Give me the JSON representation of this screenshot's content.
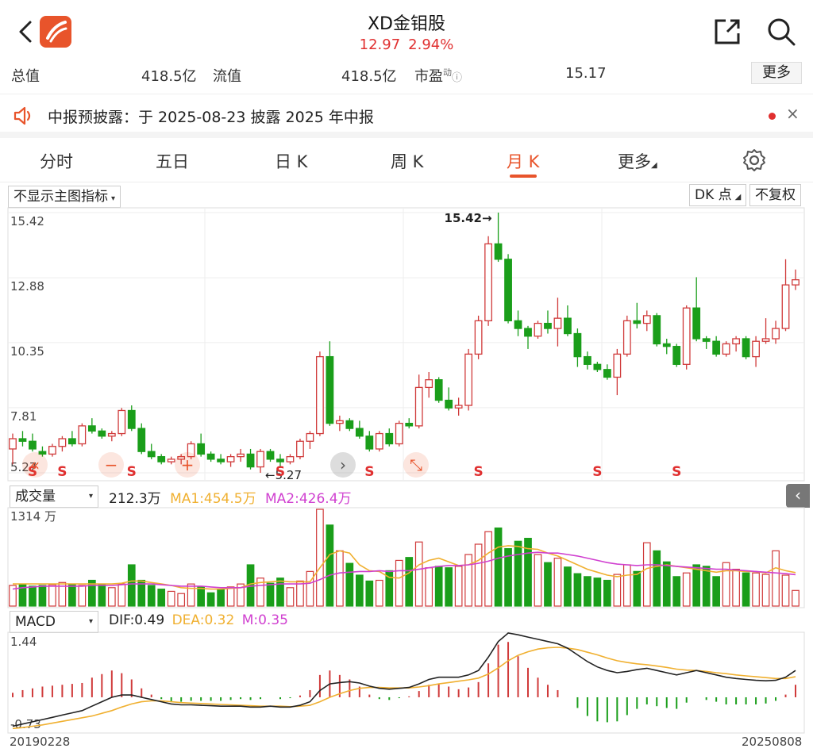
{
  "header": {
    "title": "XD金钼股",
    "price": "12.97",
    "change": "2.94%"
  },
  "stats": {
    "total_label": "总值",
    "total_value": "418.5亿",
    "float_label": "流值",
    "float_value": "418.5亿",
    "pe_label": "市盈",
    "pe_sup": "动",
    "pe_value": "15.17",
    "more_label": "更多"
  },
  "notice": {
    "text": "中报预披露：于 2025-08-23 披露 2025 年中报",
    "close": "×"
  },
  "tabs": [
    {
      "label": "分时"
    },
    {
      "label": "五日"
    },
    {
      "label": "日 K"
    },
    {
      "label": "周 K"
    },
    {
      "label": "月 K",
      "active": true
    },
    {
      "label": "更多"
    }
  ],
  "main_chart": {
    "indicator_select": "不显示主图指标",
    "dk_label": "DK 点",
    "fq_label": "不复权",
    "y_ticks": [
      "15.42",
      "12.88",
      "10.35",
      "7.81",
      "5.27"
    ],
    "max_label": "15.42",
    "min_label": "5.27",
    "signal_letter": "S",
    "colors": {
      "up": "#d03a3a",
      "down": "#1a9e1a",
      "grid": "#eeeeee"
    }
  },
  "volume": {
    "select": "成交量",
    "value": "212.3万",
    "ma1": "MA1:454.5万",
    "ma2": "MA2:426.4万",
    "y_max": "1314 万",
    "ma1_color": "#f0b030",
    "ma2_color": "#d040d0"
  },
  "macd": {
    "select": "MACD",
    "dif": "DIF:0.49",
    "dea": "DEA:0.32",
    "m": "M:0.35",
    "y_max": "1.44",
    "y_min": "-0.73"
  },
  "dates": {
    "start": "20190228",
    "end": "20250808"
  },
  "chart_data": {
    "type": "candlestick",
    "price_axis": [
      5.27,
      15.42
    ],
    "candles_ohlc": [
      [
        6.2,
        6.8,
        5.6,
        6.6
      ],
      [
        6.6,
        6.9,
        6.3,
        6.5
      ],
      [
        6.5,
        6.8,
        6.1,
        6.2
      ],
      [
        6.1,
        6.3,
        5.9,
        6.0
      ],
      [
        6.0,
        6.4,
        5.9,
        6.3
      ],
      [
        6.3,
        6.7,
        6.1,
        6.6
      ],
      [
        6.6,
        6.9,
        6.3,
        6.4
      ],
      [
        6.4,
        7.2,
        6.3,
        7.1
      ],
      [
        7.1,
        7.4,
        6.8,
        6.9
      ],
      [
        6.9,
        7.0,
        6.6,
        6.7
      ],
      [
        6.7,
        6.9,
        6.5,
        6.8
      ],
      [
        6.8,
        7.8,
        6.7,
        7.7
      ],
      [
        7.7,
        7.9,
        6.9,
        7.0
      ],
      [
        7.0,
        7.2,
        6.0,
        6.1
      ],
      [
        6.1,
        6.4,
        5.8,
        5.9
      ],
      [
        5.9,
        6.0,
        5.6,
        5.7
      ],
      [
        5.7,
        5.9,
        5.6,
        5.8
      ],
      [
        5.8,
        6.0,
        5.6,
        5.9
      ],
      [
        5.9,
        6.5,
        5.8,
        6.4
      ],
      [
        6.4,
        6.8,
        5.9,
        6.0
      ],
      [
        6.0,
        6.1,
        5.7,
        5.8
      ],
      [
        5.8,
        6.0,
        5.6,
        5.7
      ],
      [
        5.7,
        6.0,
        5.5,
        5.9
      ],
      [
        5.9,
        6.2,
        5.7,
        6.0
      ],
      [
        6.0,
        6.2,
        5.4,
        5.5
      ],
      [
        5.5,
        6.2,
        5.27,
        6.1
      ],
      [
        6.1,
        6.2,
        5.7,
        5.8
      ],
      [
        5.8,
        6.0,
        5.5,
        5.7
      ],
      [
        5.7,
        6.0,
        5.6,
        5.9
      ],
      [
        5.9,
        6.6,
        5.8,
        6.5
      ],
      [
        6.5,
        6.9,
        6.2,
        6.8
      ],
      [
        6.8,
        10.0,
        6.7,
        9.8
      ],
      [
        9.8,
        10.4,
        7.1,
        7.2
      ],
      [
        7.2,
        7.5,
        6.9,
        7.3
      ],
      [
        7.3,
        7.4,
        6.9,
        7.0
      ],
      [
        7.0,
        7.3,
        6.6,
        6.7
      ],
      [
        6.7,
        6.9,
        6.1,
        6.2
      ],
      [
        6.2,
        6.9,
        6.1,
        6.8
      ],
      [
        6.8,
        7.0,
        6.3,
        6.4
      ],
      [
        6.4,
        7.3,
        6.3,
        7.2
      ],
      [
        7.2,
        7.4,
        7.0,
        7.1
      ],
      [
        7.1,
        9.1,
        7.0,
        8.6
      ],
      [
        8.6,
        9.2,
        8.2,
        8.9
      ],
      [
        8.9,
        9.0,
        8.0,
        8.1
      ],
      [
        8.1,
        8.6,
        7.7,
        7.8
      ],
      [
        7.8,
        8.2,
        7.5,
        7.9
      ],
      [
        7.9,
        10.1,
        7.7,
        9.9
      ],
      [
        9.9,
        11.4,
        9.7,
        11.2
      ],
      [
        11.2,
        14.5,
        11.0,
        14.2
      ],
      [
        14.2,
        15.42,
        13.5,
        13.6
      ],
      [
        13.6,
        13.8,
        11.1,
        11.2
      ],
      [
        11.2,
        11.6,
        10.6,
        10.9
      ],
      [
        10.9,
        11.0,
        10.1,
        10.6
      ],
      [
        10.6,
        11.2,
        10.5,
        11.1
      ],
      [
        11.1,
        11.6,
        10.7,
        10.9
      ],
      [
        10.9,
        12.1,
        10.2,
        11.3
      ],
      [
        11.3,
        11.8,
        10.6,
        10.7
      ],
      [
        10.7,
        10.9,
        9.4,
        9.8
      ],
      [
        9.8,
        10.0,
        9.3,
        9.5
      ],
      [
        9.5,
        9.6,
        9.2,
        9.3
      ],
      [
        9.3,
        9.5,
        8.9,
        9.0
      ],
      [
        9.0,
        10.1,
        8.3,
        9.9
      ],
      [
        9.9,
        11.4,
        9.8,
        11.2
      ],
      [
        11.2,
        11.9,
        10.9,
        11.1
      ],
      [
        11.1,
        11.6,
        10.8,
        11.4
      ],
      [
        11.4,
        11.5,
        10.2,
        10.3
      ],
      [
        10.3,
        10.5,
        9.9,
        10.2
      ],
      [
        10.2,
        10.3,
        9.4,
        9.5
      ],
      [
        9.5,
        11.8,
        9.3,
        11.7
      ],
      [
        11.7,
        12.9,
        10.4,
        10.5
      ],
      [
        10.5,
        10.6,
        10.1,
        10.4
      ],
      [
        10.4,
        10.6,
        9.8,
        9.9
      ],
      [
        9.9,
        10.4,
        9.8,
        10.3
      ],
      [
        10.3,
        10.6,
        10.0,
        10.5
      ],
      [
        10.5,
        10.6,
        9.7,
        9.8
      ],
      [
        9.8,
        10.6,
        9.4,
        10.4
      ],
      [
        10.4,
        11.3,
        10.3,
        10.5
      ],
      [
        10.5,
        11.2,
        10.3,
        10.9
      ],
      [
        10.9,
        13.6,
        10.8,
        12.6
      ],
      [
        12.6,
        13.2,
        12.4,
        12.8
      ]
    ],
    "volume_wan": [
      280,
      300,
      270,
      280,
      290,
      320,
      300,
      280,
      350,
      290,
      250,
      300,
      560,
      350,
      280,
      230,
      200,
      170,
      300,
      260,
      180,
      230,
      260,
      300,
      560,
      380,
      310,
      380,
      250,
      340,
      470,
      1314,
      1100,
      750,
      580,
      420,
      340,
      350,
      480,
      620,
      660,
      870,
      520,
      540,
      520,
      540,
      700,
      840,
      1010,
      1060,
      780,
      880,
      920,
      700,
      590,
      650,
      530,
      440,
      400,
      380,
      350,
      430,
      560,
      470,
      860,
      750,
      600,
      400,
      450,
      560,
      540,
      400,
      590,
      500,
      450,
      450,
      430,
      750,
      420,
      212
    ],
    "volume_ma1_wan": [
      300,
      300,
      300,
      300,
      300,
      300,
      300,
      300,
      300,
      300,
      300,
      310,
      340,
      340,
      320,
      300,
      280,
      250,
      240,
      240,
      230,
      230,
      240,
      250,
      300,
      320,
      330,
      340,
      330,
      330,
      330,
      520,
      700,
      750,
      720,
      560,
      480,
      470,
      390,
      380,
      450,
      560,
      620,
      650,
      600,
      550,
      560,
      620,
      720,
      800,
      820,
      810,
      780,
      770,
      720,
      680,
      620,
      560,
      500,
      460,
      420,
      400,
      420,
      430,
      510,
      540,
      560,
      540,
      520,
      500,
      480,
      460,
      480,
      480,
      470,
      470,
      450,
      520,
      480,
      454
    ],
    "volume_ma2_wan": [
      230,
      250,
      260,
      270,
      270,
      270,
      270,
      270,
      280,
      280,
      280,
      290,
      300,
      300,
      300,
      290,
      280,
      270,
      270,
      270,
      260,
      250,
      250,
      250,
      270,
      280,
      290,
      300,
      300,
      300,
      310,
      360,
      420,
      450,
      460,
      470,
      470,
      480,
      470,
      480,
      480,
      500,
      520,
      540,
      550,
      550,
      560,
      580,
      610,
      650,
      680,
      700,
      720,
      730,
      720,
      720,
      700,
      680,
      650,
      620,
      590,
      570,
      560,
      550,
      560,
      560,
      550,
      540,
      530,
      520,
      510,
      500,
      500,
      490,
      480,
      470,
      460,
      450,
      440,
      426
    ],
    "macd_dif": [
      -0.65,
      -0.6,
      -0.55,
      -0.5,
      -0.45,
      -0.4,
      -0.35,
      -0.3,
      -0.2,
      -0.1,
      0.0,
      0.05,
      0.05,
      0.0,
      -0.05,
      -0.1,
      -0.15,
      -0.17,
      -0.17,
      -0.18,
      -0.19,
      -0.2,
      -0.2,
      -0.2,
      -0.22,
      -0.22,
      -0.2,
      -0.22,
      -0.22,
      -0.18,
      -0.1,
      0.15,
      0.3,
      0.33,
      0.35,
      0.32,
      0.25,
      0.2,
      0.18,
      0.2,
      0.22,
      0.3,
      0.4,
      0.45,
      0.45,
      0.45,
      0.5,
      0.6,
      0.9,
      1.25,
      1.44,
      1.4,
      1.35,
      1.3,
      1.25,
      1.2,
      1.1,
      0.95,
      0.8,
      0.68,
      0.6,
      0.55,
      0.58,
      0.62,
      0.65,
      0.6,
      0.55,
      0.5,
      0.55,
      0.6,
      0.55,
      0.5,
      0.45,
      0.42,
      0.4,
      0.38,
      0.37,
      0.38,
      0.45,
      0.6
    ],
    "macd_dea": [
      -0.7,
      -0.68,
      -0.65,
      -0.62,
      -0.58,
      -0.54,
      -0.5,
      -0.46,
      -0.42,
      -0.36,
      -0.3,
      -0.22,
      -0.15,
      -0.1,
      -0.08,
      -0.08,
      -0.1,
      -0.12,
      -0.13,
      -0.14,
      -0.15,
      -0.16,
      -0.17,
      -0.18,
      -0.19,
      -0.2,
      -0.2,
      -0.2,
      -0.21,
      -0.2,
      -0.18,
      -0.1,
      0.0,
      0.08,
      0.15,
      0.2,
      0.22,
      0.22,
      0.21,
      0.21,
      0.21,
      0.23,
      0.26,
      0.3,
      0.33,
      0.36,
      0.39,
      0.43,
      0.52,
      0.66,
      0.82,
      0.94,
      1.02,
      1.08,
      1.11,
      1.12,
      1.1,
      1.07,
      1.01,
      0.95,
      0.88,
      0.82,
      0.78,
      0.75,
      0.73,
      0.7,
      0.67,
      0.63,
      0.61,
      0.6,
      0.58,
      0.55,
      0.53,
      0.5,
      0.48,
      0.46,
      0.44,
      0.42,
      0.42,
      0.46
    ]
  }
}
